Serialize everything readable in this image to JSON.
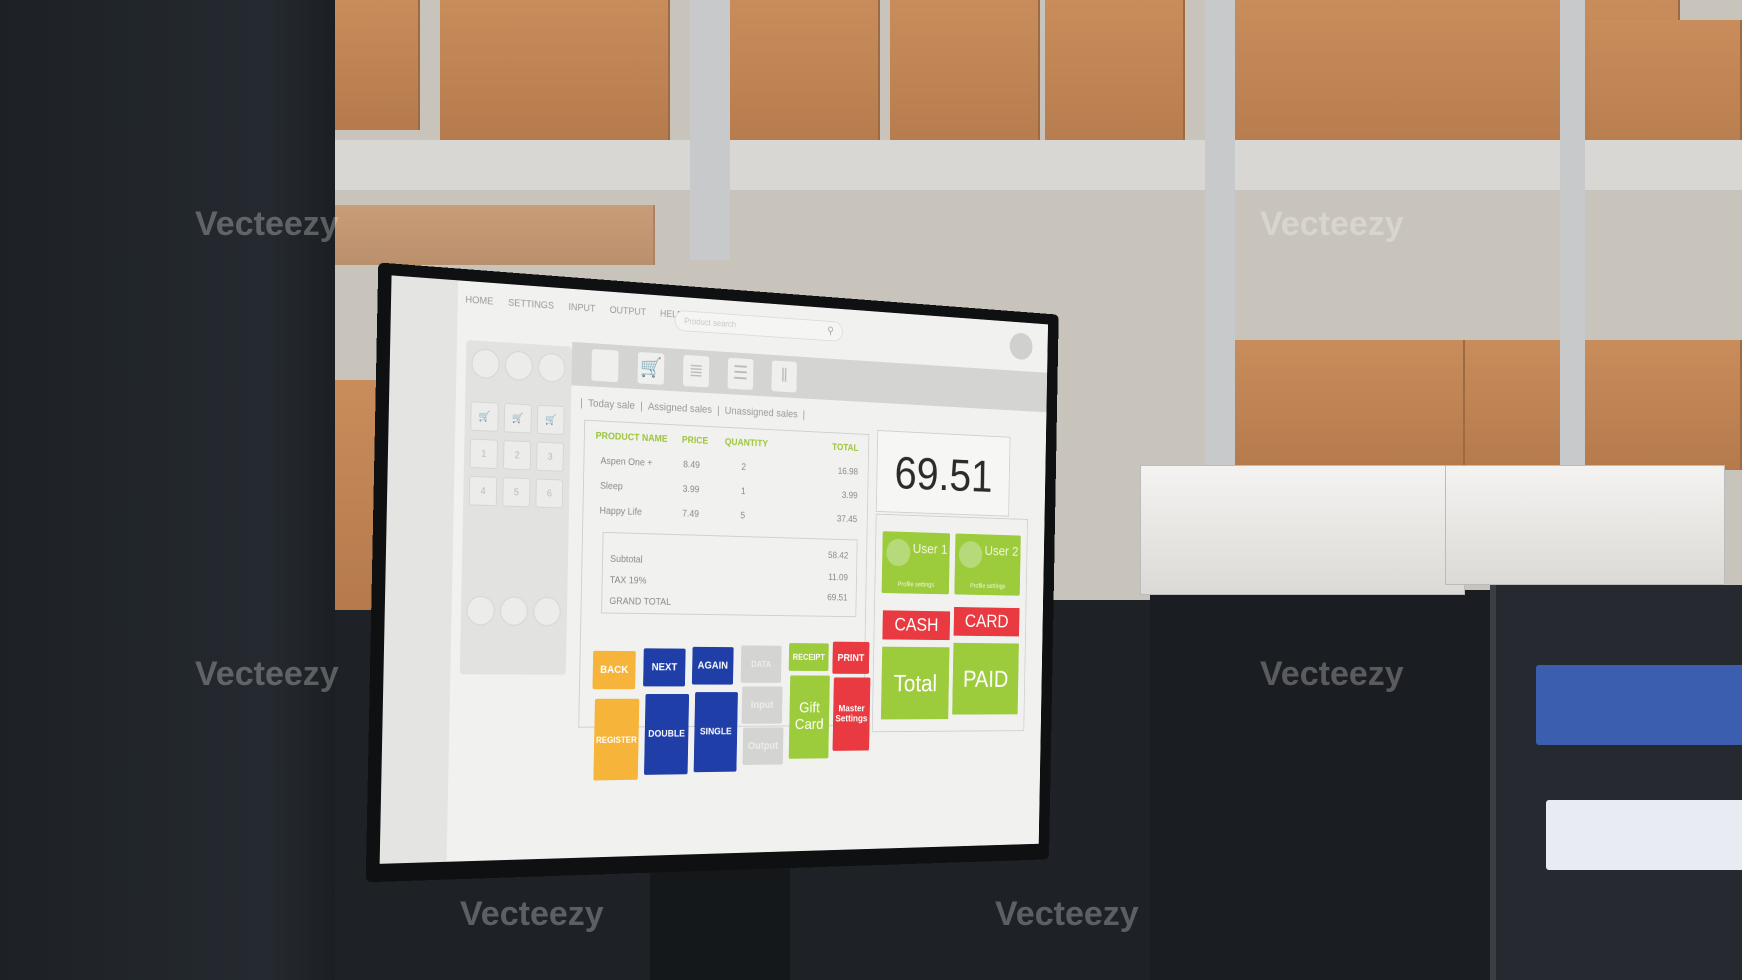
{
  "pos": {
    "nav": [
      "HOME",
      "SETTINGS",
      "INPUT",
      "OUTPUT",
      "HELP"
    ],
    "search_placeholder": "Product search",
    "tabs": [
      "Today sale",
      "Assigned sales",
      "Unassigned sales"
    ],
    "columns": [
      "PRODUCT NAME",
      "PRICE",
      "QUANTITY",
      "TOTAL"
    ],
    "rows": [
      {
        "name": "Aspen One +",
        "price": "8.49",
        "qty": "2",
        "total": "16.98"
      },
      {
        "name": "Sleep",
        "price": "3.99",
        "qty": "1",
        "total": "3.99"
      },
      {
        "name": "Happy Life",
        "price": "7.49",
        "qty": "5",
        "total": "37.45"
      }
    ],
    "summary": [
      {
        "label": "Subtotal",
        "value": "58.42"
      },
      {
        "label": "TAX 19%",
        "value": "11.09"
      },
      {
        "label": "GRAND TOTAL",
        "value": "69.51"
      }
    ],
    "display_total": "69.51",
    "users": [
      {
        "name": "User 1",
        "settings": "Profile settings"
      },
      {
        "name": "User 2",
        "settings": "Profile settings"
      }
    ],
    "pay": {
      "cash": "CASH",
      "card": "CARD",
      "total": "Total",
      "paid": "PAID"
    },
    "buttons": {
      "back": "BACK",
      "register": "REGISTER",
      "next": "NEXT",
      "again": "AGAIN",
      "double": "DOUBLE",
      "single": "SINGLE",
      "data": "DATA",
      "input": "Input",
      "output": "Output",
      "receipt": "RECEIPT",
      "gift": "Gift Card",
      "print": "PRINT",
      "master": "Master Settings"
    },
    "keypad": [
      "1",
      "2",
      "3",
      "4",
      "5",
      "6"
    ]
  },
  "colors": {
    "green": "#9ccc3c",
    "red": "#e83a40",
    "blue": "#1f3ea8",
    "yellow": "#f6b53a"
  },
  "watermark": "Vecteezy"
}
